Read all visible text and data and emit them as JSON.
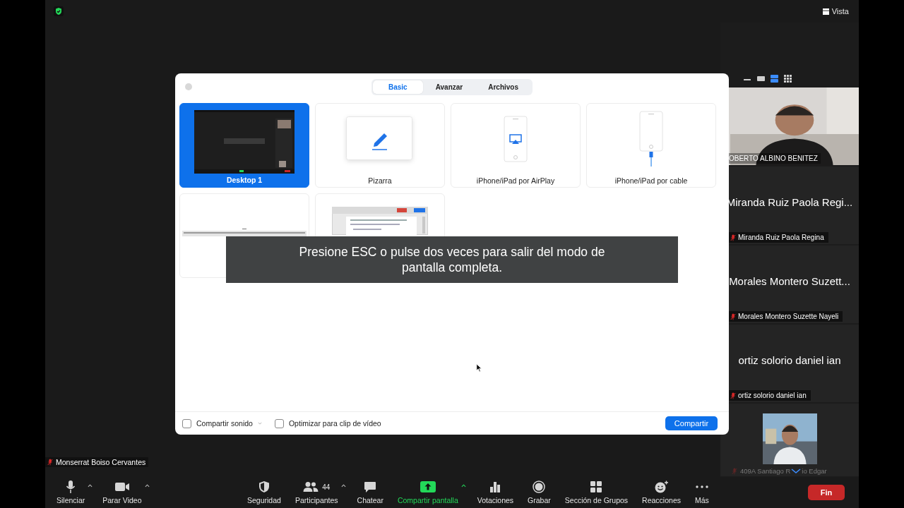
{
  "top_bar": {
    "secure": true,
    "view_button": "Vista"
  },
  "share_dialog": {
    "tabs": [
      {
        "label": "Basic",
        "selected": true
      },
      {
        "label": "Avanzar",
        "selected": false
      },
      {
        "label": "Archivos",
        "selected": false
      }
    ],
    "sources": [
      {
        "kind": "screen",
        "label": "Desktop 1",
        "selected": true
      },
      {
        "kind": "whiteboard",
        "label": "Pizarra",
        "selected": false
      },
      {
        "kind": "airplay",
        "label": "iPhone/iPad por AirPlay",
        "selected": false
      },
      {
        "kind": "cable",
        "label": "iPhone/iPad por cable",
        "selected": false
      },
      {
        "kind": "window",
        "selected": false
      },
      {
        "kind": "document",
        "selected": false
      }
    ],
    "options": [
      {
        "label": "Compartir sonido",
        "checked": false,
        "dropdown": true
      },
      {
        "label": "Optimizar para clip de vídeo",
        "checked": false,
        "dropdown": false
      }
    ],
    "share_button": "Compartir"
  },
  "fullscreen_notice": "Presione ESC o pulse dos veces para salir del modo de pantalla completa.",
  "gallery": {
    "view_modes": [
      {
        "kind": "minimize",
        "selected": false
      },
      {
        "kind": "thumbnail",
        "selected": false
      },
      {
        "kind": "strip",
        "selected": true
      },
      {
        "kind": "grid",
        "selected": false
      }
    ],
    "participants": [
      {
        "kind": "video",
        "name": "OBERTO ALBINO BENITEZ",
        "muted": false
      },
      {
        "kind": "name",
        "display_name": "Miranda Ruiz Paola Regi...",
        "name": "Miranda Ruiz Paola Regina",
        "muted": true
      },
      {
        "kind": "name",
        "display_name": "Morales Montero Suzett...",
        "name": "Morales Montero Suzette Nayeli",
        "muted": true
      },
      {
        "kind": "name",
        "display_name": "ortiz solorio daniel ian",
        "name": "ortiz solorio daniel ian",
        "muted": true
      },
      {
        "kind": "avatar",
        "name": "409A Santiago R",
        "name_end": "io Edgar",
        "muted": true
      }
    ]
  },
  "active_speaker": {
    "name": "Monserrat Boiso Cervantes",
    "muted": true
  },
  "toolbar": {
    "left": [
      {
        "kind": "mic",
        "label": "Silenciar",
        "menu": true,
        "active": false
      },
      {
        "kind": "camera",
        "label": "Parar Video",
        "menu": true,
        "active": false
      }
    ],
    "center": [
      {
        "kind": "security",
        "label": "Seguridad",
        "menu": false,
        "active": false
      },
      {
        "kind": "participants",
        "label": "Participantes",
        "badge": "44",
        "menu": true,
        "active": false
      },
      {
        "kind": "chat",
        "label": "Chatear",
        "menu": false,
        "active": false
      },
      {
        "kind": "share",
        "label": "Compartir pantalla",
        "menu": true,
        "active": true
      },
      {
        "kind": "polls",
        "label": "Votaciones",
        "menu": false,
        "active": false
      },
      {
        "kind": "record",
        "label": "Grabar",
        "menu": false,
        "active": false
      },
      {
        "kind": "rooms",
        "label": "Sección de Grupos",
        "menu": false,
        "active": false
      },
      {
        "kind": "reactions",
        "label": "Reacciones",
        "menu": false,
        "active": false
      },
      {
        "kind": "more",
        "label": "Más",
        "menu": false,
        "active": false
      }
    ],
    "end_button": "Fin"
  }
}
